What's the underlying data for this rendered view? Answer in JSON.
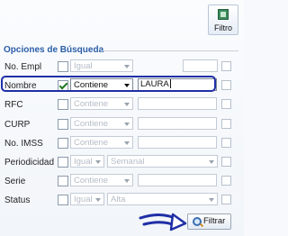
{
  "toolbar": {
    "filtro_label": "Filtro"
  },
  "section": {
    "legend": "Opciones de Búsqueda"
  },
  "rows": [
    {
      "label": "No. Empl",
      "checked": false,
      "operator": "Igual",
      "value": "",
      "extra": ""
    },
    {
      "label": "Nombre",
      "checked": true,
      "operator": "Contiene",
      "value": "LAURA",
      "extra": ""
    },
    {
      "label": "RFC",
      "checked": false,
      "operator": "Contiene",
      "value": "",
      "extra": ""
    },
    {
      "label": "CURP",
      "checked": false,
      "operator": "Contiene",
      "value": "",
      "extra": ""
    },
    {
      "label": "No. IMSS",
      "checked": false,
      "operator": "Contiene",
      "value": "",
      "extra": ""
    },
    {
      "label": "Periodicidad",
      "checked": false,
      "operator": "Igual",
      "value": "",
      "extra": "Semanal"
    },
    {
      "label": "Serie",
      "checked": false,
      "operator": "Contiene",
      "value": "",
      "extra": ""
    },
    {
      "label": "Status",
      "checked": false,
      "operator": "Igual",
      "value": "",
      "extra": "Alta"
    }
  ],
  "footer": {
    "filtrar_label": "Filtrar"
  },
  "colors": {
    "legend": "#2b5da6",
    "highlight": "#1f2fa6"
  }
}
